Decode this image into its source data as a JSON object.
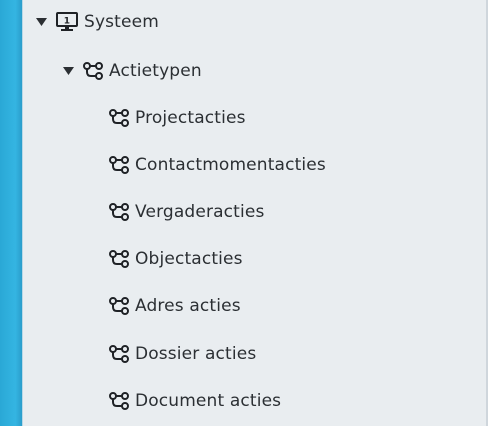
{
  "tree": {
    "root": {
      "label": "Systeem",
      "icon": "monitor-icon",
      "monitor_badge": "1",
      "expanded": true
    },
    "group": {
      "label": "Actietypen",
      "icon": "workflow-icon",
      "expanded": true
    },
    "items": [
      {
        "label": "Projectacties",
        "icon": "workflow-icon"
      },
      {
        "label": "Contactmomentacties",
        "icon": "workflow-icon"
      },
      {
        "label": "Vergaderacties",
        "icon": "workflow-icon"
      },
      {
        "label": "Objectacties",
        "icon": "workflow-icon"
      },
      {
        "label": "Adres acties",
        "icon": "workflow-icon"
      },
      {
        "label": "Dossier acties",
        "icon": "workflow-icon"
      },
      {
        "label": "Document acties",
        "icon": "workflow-icon"
      }
    ]
  },
  "colors": {
    "panel_bg": "#e9edf0",
    "accent_strip": "#34b5e2",
    "text": "#2b2f33"
  }
}
